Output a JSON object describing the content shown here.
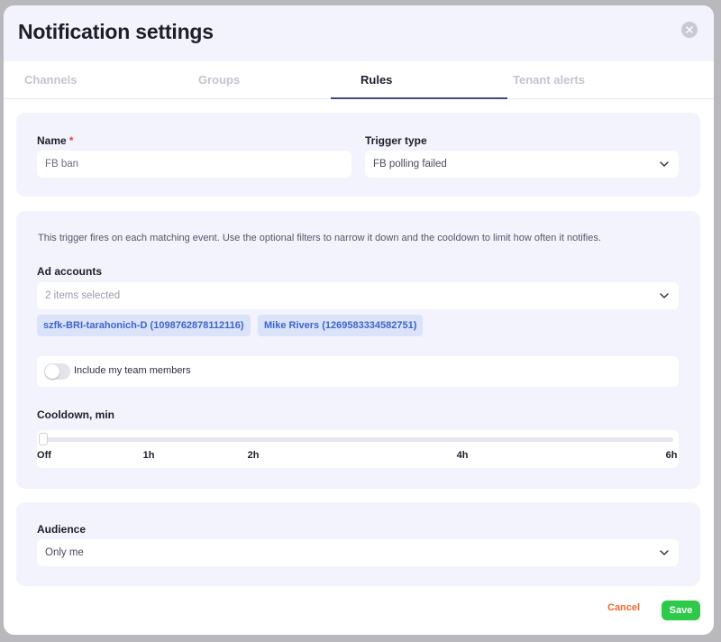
{
  "modal": {
    "title": "Notification settings"
  },
  "tabs": [
    {
      "label": "Channels",
      "active": false
    },
    {
      "label": "Groups",
      "active": false
    },
    {
      "label": "Rules",
      "active": true
    },
    {
      "label": "Tenant alerts",
      "active": false
    }
  ],
  "rule": {
    "name_label": "Name",
    "required_marker": "*",
    "name_value": "FB ban",
    "trigger_label": "Trigger type",
    "trigger_value": "FB polling failed"
  },
  "filters": {
    "description": "This trigger fires on each matching event. Use the optional filters to narrow it down and the cooldown to limit how often it notifies.",
    "ad_accounts_label": "Ad accounts",
    "ad_accounts_summary": "2 items selected",
    "chips": [
      "szfk-BRI-tarahonich-D (1098762878112116)",
      "Mike Rivers (1269583334582751)"
    ],
    "include_team_label": "Include my team members",
    "include_team_enabled": false,
    "cooldown_label": "Cooldown, min",
    "cooldown_value": "Off",
    "cooldown_ticks": [
      "Off",
      "1h",
      "2h",
      "4h",
      "6h"
    ]
  },
  "audience": {
    "label": "Audience",
    "value": "Only me"
  },
  "footer": {
    "cancel_label": "Cancel",
    "save_label": "Save"
  },
  "colors": {
    "accent": "#3f4a8a",
    "save": "#2fc94a",
    "cancel": "#f06a2a",
    "chip_bg": "#dbe3fa",
    "chip_text": "#3f64c9",
    "required": "#e0483c"
  },
  "icons": {
    "close": "close-icon",
    "dropdown": "chevron-down-icon"
  }
}
